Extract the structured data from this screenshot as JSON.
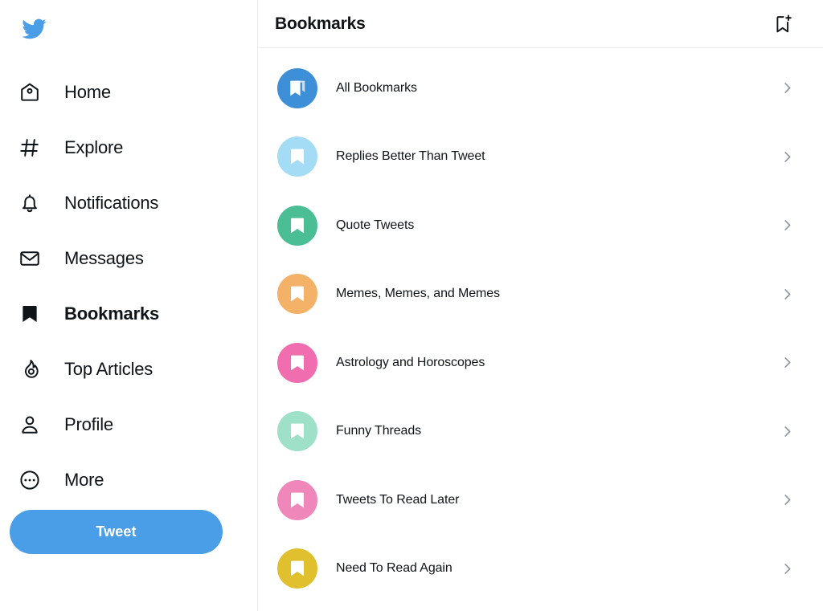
{
  "brand": {
    "logo_icon": "twitter-bird-icon",
    "accent_color": "#4a9ee8"
  },
  "sidebar": {
    "items": [
      {
        "label": "Home",
        "icon": "home-icon",
        "active": false
      },
      {
        "label": "Explore",
        "icon": "hashtag-icon",
        "active": false
      },
      {
        "label": "Notifications",
        "icon": "bell-icon",
        "active": false
      },
      {
        "label": "Messages",
        "icon": "envelope-icon",
        "active": false
      },
      {
        "label": "Bookmarks",
        "icon": "bookmark-filled-icon",
        "active": true
      },
      {
        "label": "Top Articles",
        "icon": "flame-icon",
        "active": false
      },
      {
        "label": "Profile",
        "icon": "person-icon",
        "active": false
      },
      {
        "label": "More",
        "icon": "ellipsis-circle-icon",
        "active": false
      }
    ],
    "compose_button": {
      "label": "Tweet",
      "color": "#4a9ee8"
    }
  },
  "header": {
    "title": "Bookmarks",
    "action_icon": "bookmark-add-icon"
  },
  "bookmarks": {
    "chevron_icon": "chevron-right-icon",
    "chevron_color": "#8b98a5",
    "items": [
      {
        "label": "All Bookmarks",
        "color": "#3d8fd8",
        "icon": "bookmarks-stack-icon"
      },
      {
        "label": "Replies Better Than Tweet",
        "color": "#a5dcf5",
        "icon": "bookmark-icon"
      },
      {
        "label": "Quote Tweets",
        "color": "#4bbe96",
        "icon": "bookmark-icon"
      },
      {
        "label": "Memes, Memes, and Memes",
        "color": "#f3b267",
        "icon": "bookmark-icon"
      },
      {
        "label": "Astrology and Horoscopes",
        "color": "#f06db0",
        "icon": "bookmark-icon"
      },
      {
        "label": "Funny Threads",
        "color": "#9ee0c8",
        "icon": "bookmark-icon"
      },
      {
        "label": "Tweets To Read Later",
        "color": "#f087ba",
        "icon": "bookmark-icon"
      },
      {
        "label": "Need To Read Again",
        "color": "#e0c02e",
        "icon": "bookmark-icon"
      }
    ]
  }
}
